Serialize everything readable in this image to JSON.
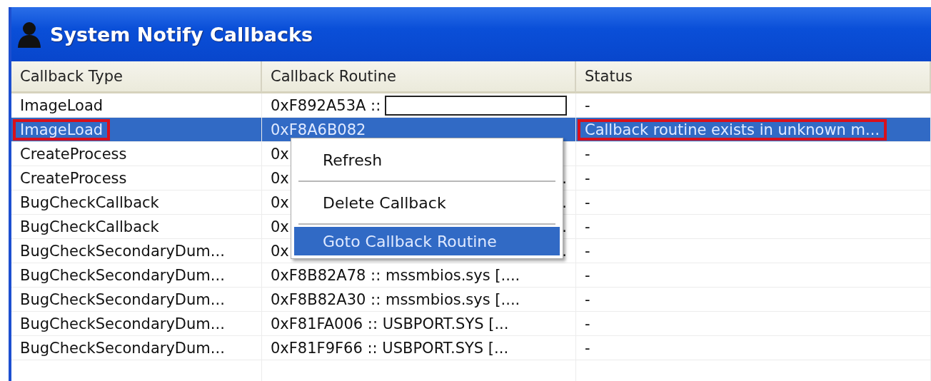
{
  "window": {
    "title": "System Notify Callbacks"
  },
  "table": {
    "columns": [
      "Callback Type",
      "Callback Routine",
      "Status"
    ],
    "rows": [
      {
        "type": "ImageLoad",
        "routine": "0xF892A53A ::",
        "editing": true,
        "status": "-",
        "selected": false,
        "highlighted": false
      },
      {
        "type": "ImageLoad",
        "routine": "0xF8A6B082",
        "status": "Callback routine exists in unknown m...",
        "selected": true,
        "highlighted": true
      },
      {
        "type": "CreateProcess",
        "routine": "0x",
        "status": "-",
        "selected": false,
        "highlighted": false
      },
      {
        "type": "CreateProcess",
        "routine": "0x",
        "routine_tail": ".",
        "status": "-",
        "selected": false,
        "highlighted": false
      },
      {
        "type": "BugCheckCallback",
        "routine": "0x",
        "routine_tail": ".",
        "status": "-",
        "selected": false,
        "highlighted": false
      },
      {
        "type": "BugCheckCallback",
        "routine": "0x",
        "routine_tail": ".",
        "status": "-",
        "selected": false,
        "highlighted": false
      },
      {
        "type": "BugCheckSecondaryDum...",
        "routine": "0x",
        "routine_tail": ".",
        "status": "-",
        "selected": false,
        "highlighted": false
      },
      {
        "type": "BugCheckSecondaryDum...",
        "routine": "0xF8B82A78 :: mssmbios.sys [....",
        "status": "-",
        "selected": false,
        "highlighted": false
      },
      {
        "type": "BugCheckSecondaryDum...",
        "routine": "0xF8B82A30 :: mssmbios.sys [....",
        "status": "-",
        "selected": false,
        "highlighted": false
      },
      {
        "type": "BugCheckSecondaryDum...",
        "routine": "0xF81FA006 :: USBPORT.SYS [...",
        "status": "-",
        "selected": false,
        "highlighted": false
      },
      {
        "type": "BugCheckSecondaryDum...",
        "routine": "0xF81F9F66 :: USBPORT.SYS [...",
        "status": "-",
        "selected": false,
        "highlighted": false
      }
    ]
  },
  "context_menu": {
    "items": [
      {
        "label": "Refresh",
        "selected": false
      },
      {
        "label": "Delete Callback",
        "selected": false
      },
      {
        "label": "Goto Callback Routine",
        "selected": true
      }
    ]
  }
}
